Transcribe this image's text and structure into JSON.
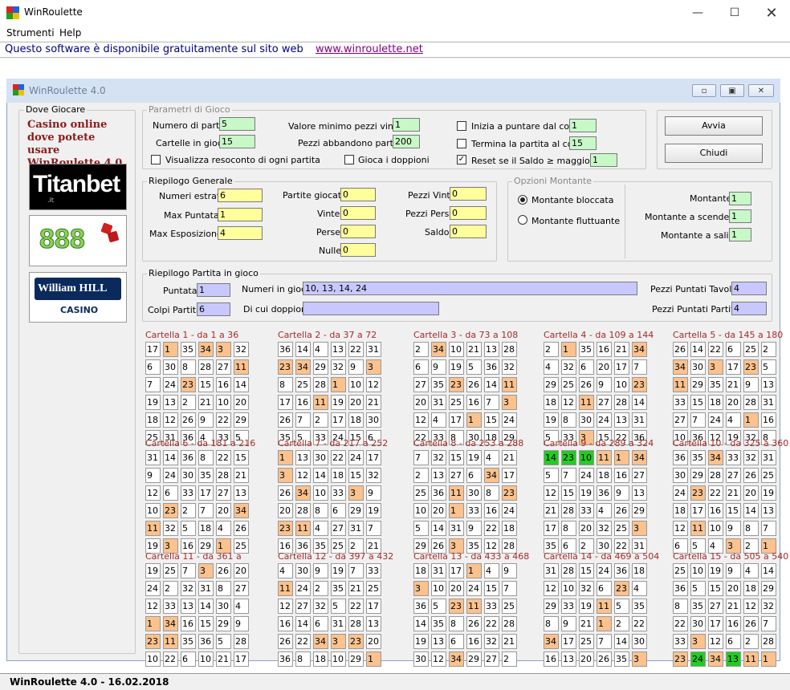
{
  "window": {
    "title": "WinRoulette"
  },
  "menu": [
    "Strumenti",
    "Help"
  ],
  "banner": {
    "text": "Questo software è disponibile gratuitamente sul sito web",
    "link": "www.winroulette.net"
  },
  "child": {
    "title": "WinRoulette 4.0"
  },
  "dove_giocare": {
    "legend": "Dove Giocare",
    "promo": "Casino online dove potete usare WinRoulette 4.0",
    "logos": [
      {
        "name": "Titanbet",
        "text": "Titanbet",
        "sub": ".it"
      },
      {
        "name": "888",
        "text": "888"
      },
      {
        "name": "William Hill",
        "text": "William HILL",
        "sub": "CASINO"
      }
    ]
  },
  "parametri": {
    "legend": "Parametri di Gioco",
    "numero_partite": {
      "label": "Numero di partite",
      "value": "5"
    },
    "cartelle_in_gioco": {
      "label": "Cartelle in gioco",
      "value": "15"
    },
    "visualizza": {
      "label": "Visualizza resoconto di ogni partita",
      "checked": false
    },
    "valore_minimo": {
      "label": "Valore minimo pezzi vincita",
      "value": "1"
    },
    "pezzi_abbandono": {
      "label": "Pezzi abbandono partita",
      "value": "200"
    },
    "gioca_doppioni": {
      "label": "Gioca i doppioni",
      "checked": false
    },
    "inizia": {
      "label": "Inizia a puntare dal colpo",
      "value": "1",
      "checked": false
    },
    "termina": {
      "label": "Termina la partita al colpo",
      "value": "15",
      "checked": false
    },
    "reset": {
      "label": "Reset se il Saldo ≥ maggiore di",
      "value": "1",
      "checked": true
    }
  },
  "buttons": {
    "avvia": "Avvia",
    "chiudi": "Chiudi"
  },
  "riepilogo_generale": {
    "legend": "Riepilogo Generale",
    "numeri_estratti": {
      "label": "Numeri estratti",
      "value": "6"
    },
    "max_puntata": {
      "label": "Max Puntata",
      "value": "1"
    },
    "max_esposizione": {
      "label": "Max Esposizione",
      "value": "4"
    },
    "partite_giocate": {
      "label": "Partite giocate",
      "value": "0"
    },
    "vinte": {
      "label": "Vinte",
      "value": "0"
    },
    "perse": {
      "label": "Perse",
      "value": "0"
    },
    "nulle": {
      "label": "Nulle",
      "value": "0"
    },
    "pezzi_vinti": {
      "label": "Pezzi Vinti",
      "value": "0"
    },
    "pezzi_persi": {
      "label": "Pezzi Persi",
      "value": "0"
    },
    "saldo": {
      "label": "Saldo",
      "value": "0"
    }
  },
  "opzioni_montante": {
    "legend": "Opzioni Montante",
    "bloccata": {
      "label": "Montante bloccata",
      "selected": true
    },
    "fluttuante": {
      "label": "Montante fluttuante",
      "selected": false
    },
    "montante": {
      "label": "Montante",
      "value": "1"
    },
    "scendere": {
      "label": "Montante a scendere",
      "value": "1"
    },
    "salire": {
      "label": "Montante a salire",
      "value": "1"
    }
  },
  "riepilogo_partita": {
    "legend": "Riepilogo Partita in gioco",
    "puntata": {
      "label": "Puntata",
      "value": "1"
    },
    "colpi_partita": {
      "label": "Colpi Partita",
      "value": "6"
    },
    "numeri_in_gioco": {
      "label": "Numeri in gioco",
      "value": "10, 13, 14, 24"
    },
    "di_cui_doppioni": {
      "label": "Di cui doppioni",
      "value": ""
    },
    "pezzi_tavolo": {
      "label": "Pezzi Puntati Tavolo",
      "value": "4"
    },
    "pezzi_partita": {
      "label": "Pezzi Puntati Partita",
      "value": "4"
    }
  },
  "cartelle": [
    {
      "title": "Cartella 1 - da 1 a 36",
      "rows": [
        [
          "17",
          "1",
          "35",
          "34",
          "3",
          "32"
        ],
        [
          "6",
          "30",
          "8",
          "28",
          "27",
          "11"
        ],
        [
          "7",
          "24",
          "23",
          "15",
          "16",
          "14"
        ],
        [
          "19",
          "13",
          "2",
          "21",
          "10",
          "20"
        ],
        [
          "18",
          "12",
          "26",
          "9",
          "22",
          "29"
        ],
        [
          "25",
          "31",
          "36",
          "4",
          "33",
          "5"
        ]
      ],
      "marks": [
        [
          0,
          1
        ],
        [
          0,
          3
        ],
        [
          0,
          4
        ],
        [
          1,
          5
        ],
        [
          2,
          2
        ]
      ]
    },
    {
      "title": "Cartella 2 - da 37 a 72",
      "rows": [
        [
          "36",
          "14",
          "4",
          "13",
          "22",
          "31"
        ],
        [
          "23",
          "34",
          "29",
          "32",
          "9",
          "3"
        ],
        [
          "8",
          "25",
          "28",
          "1",
          "10",
          "12"
        ],
        [
          "17",
          "16",
          "11",
          "19",
          "20",
          "21"
        ],
        [
          "26",
          "7",
          "2",
          "17",
          "18",
          "30"
        ],
        [
          "35",
          "5",
          "33",
          "24",
          "15",
          "6"
        ]
      ],
      "marks": [
        [
          1,
          0
        ],
        [
          1,
          1
        ],
        [
          1,
          5
        ],
        [
          2,
          3
        ],
        [
          3,
          2
        ]
      ]
    },
    {
      "title": "Cartella 3 - da 73 a 108",
      "rows": [
        [
          "2",
          "34",
          "10",
          "21",
          "13",
          "28"
        ],
        [
          "6",
          "9",
          "19",
          "5",
          "36",
          "32"
        ],
        [
          "27",
          "35",
          "23",
          "26",
          "14",
          "11"
        ],
        [
          "20",
          "31",
          "25",
          "16",
          "7",
          "3"
        ],
        [
          "12",
          "4",
          "17",
          "1",
          "15",
          "24"
        ],
        [
          "22",
          "33",
          "8",
          "30",
          "18",
          "29"
        ]
      ],
      "marks": [
        [
          0,
          1
        ],
        [
          2,
          2
        ],
        [
          2,
          5
        ],
        [
          3,
          5
        ],
        [
          4,
          3
        ]
      ]
    },
    {
      "title": "Cartella 4 - da 109 a 144",
      "rows": [
        [
          "2",
          "1",
          "35",
          "16",
          "21",
          "34"
        ],
        [
          "4",
          "32",
          "6",
          "20",
          "17",
          "7"
        ],
        [
          "29",
          "25",
          "26",
          "9",
          "10",
          "23"
        ],
        [
          "18",
          "12",
          "11",
          "27",
          "28",
          "14"
        ],
        [
          "19",
          "8",
          "30",
          "24",
          "13",
          "31"
        ],
        [
          "5",
          "33",
          "3",
          "15",
          "22",
          "36"
        ]
      ],
      "marks": [
        [
          0,
          1
        ],
        [
          0,
          5
        ],
        [
          2,
          5
        ],
        [
          3,
          2
        ],
        [
          5,
          2
        ]
      ]
    },
    {
      "title": "Cartella 5 - da 145 a 180",
      "rows": [
        [
          "26",
          "14",
          "22",
          "6",
          "25",
          "2"
        ],
        [
          "34",
          "30",
          "3",
          "17",
          "23",
          "5"
        ],
        [
          "11",
          "29",
          "35",
          "21",
          "9",
          "13"
        ],
        [
          "33",
          "15",
          "18",
          "20",
          "28",
          "31"
        ],
        [
          "27",
          "7",
          "24",
          "4",
          "1",
          "16"
        ],
        [
          "10",
          "36",
          "12",
          "19",
          "32",
          "8"
        ]
      ],
      "marks": [
        [
          1,
          0
        ],
        [
          1,
          2
        ],
        [
          1,
          4
        ],
        [
          2,
          0
        ],
        [
          4,
          4
        ]
      ]
    },
    {
      "title": "Cartella 6 - da 181 a 216",
      "rows": [
        [
          "31",
          "14",
          "36",
          "8",
          "22",
          "15"
        ],
        [
          "9",
          "24",
          "30",
          "35",
          "28",
          "21"
        ],
        [
          "12",
          "6",
          "33",
          "17",
          "27",
          "13"
        ],
        [
          "10",
          "23",
          "2",
          "7",
          "20",
          "34"
        ],
        [
          "11",
          "32",
          "5",
          "18",
          "4",
          "26"
        ],
        [
          "19",
          "3",
          "16",
          "29",
          "1",
          "25"
        ]
      ],
      "marks": [
        [
          3,
          1
        ],
        [
          3,
          5
        ],
        [
          4,
          0
        ],
        [
          5,
          1
        ],
        [
          5,
          4
        ]
      ]
    },
    {
      "title": "Cartella 7 - da 217 a 252",
      "rows": [
        [
          "1",
          "13",
          "30",
          "22",
          "24",
          "17"
        ],
        [
          "3",
          "12",
          "14",
          "18",
          "15",
          "32"
        ],
        [
          "26",
          "34",
          "10",
          "33",
          "3",
          "9"
        ],
        [
          "20",
          "28",
          "8",
          "6",
          "29",
          "19"
        ],
        [
          "23",
          "11",
          "4",
          "27",
          "31",
          "7"
        ],
        [
          "16",
          "36",
          "35",
          "25",
          "2",
          "21"
        ]
      ],
      "marks": [
        [
          0,
          0
        ],
        [
          1,
          0
        ],
        [
          2,
          1
        ],
        [
          2,
          4
        ],
        [
          4,
          0
        ],
        [
          4,
          1
        ]
      ]
    },
    {
      "title": "Cartella 8 - da 253 a 288",
      "rows": [
        [
          "7",
          "32",
          "15",
          "19",
          "4",
          "21"
        ],
        [
          "2",
          "13",
          "27",
          "6",
          "34",
          "17"
        ],
        [
          "25",
          "36",
          "11",
          "30",
          "8",
          "23"
        ],
        [
          "10",
          "20",
          "1",
          "33",
          "16",
          "24"
        ],
        [
          "5",
          "14",
          "31",
          "9",
          "22",
          "18"
        ],
        [
          "29",
          "26",
          "3",
          "35",
          "12",
          "28"
        ]
      ],
      "marks": [
        [
          1,
          4
        ],
        [
          2,
          2
        ],
        [
          2,
          5
        ],
        [
          3,
          2
        ],
        [
          5,
          2
        ]
      ]
    },
    {
      "title": "Cartella 9 - da 289 a 324",
      "rows": [
        [
          "14",
          "23",
          "10",
          "11",
          "1",
          "34"
        ],
        [
          "5",
          "7",
          "24",
          "18",
          "16",
          "27"
        ],
        [
          "12",
          "15",
          "19",
          "36",
          "9",
          "13"
        ],
        [
          "21",
          "28",
          "33",
          "4",
          "26",
          "29"
        ],
        [
          "17",
          "8",
          "20",
          "32",
          "25",
          "3"
        ],
        [
          "35",
          "6",
          "2",
          "30",
          "22",
          "31"
        ]
      ],
      "marks": [
        [
          0,
          3
        ],
        [
          0,
          4
        ],
        [
          0,
          5
        ],
        [
          4,
          5
        ]
      ],
      "green": [
        [
          0,
          0
        ],
        [
          0,
          1
        ],
        [
          0,
          2
        ]
      ]
    },
    {
      "title": "Cartella 10 - da 325 a 360",
      "rows": [
        [
          "36",
          "35",
          "34",
          "33",
          "32",
          "31"
        ],
        [
          "30",
          "29",
          "28",
          "27",
          "26",
          "25"
        ],
        [
          "24",
          "23",
          "22",
          "21",
          "20",
          "19"
        ],
        [
          "18",
          "17",
          "16",
          "15",
          "14",
          "13"
        ],
        [
          "12",
          "11",
          "10",
          "9",
          "8",
          "7"
        ],
        [
          "6",
          "5",
          "4",
          "3",
          "2",
          "1"
        ]
      ],
      "marks": [
        [
          0,
          2
        ],
        [
          2,
          1
        ],
        [
          4,
          1
        ],
        [
          5,
          3
        ],
        [
          5,
          5
        ]
      ]
    },
    {
      "title": "Cartella 11 - da 361 a",
      "rows": [
        [
          "19",
          "25",
          "7",
          "3",
          "26",
          "20"
        ],
        [
          "24",
          "2",
          "32",
          "31",
          "8",
          "27"
        ],
        [
          "12",
          "33",
          "13",
          "14",
          "30",
          "4"
        ],
        [
          "1",
          "34",
          "16",
          "15",
          "29",
          "9"
        ],
        [
          "23",
          "11",
          "35",
          "36",
          "5",
          "28"
        ],
        [
          "10",
          "22",
          "6",
          "10",
          "21",
          "17"
        ]
      ],
      "marks": [
        [
          0,
          3
        ],
        [
          3,
          0
        ],
        [
          3,
          1
        ],
        [
          4,
          0
        ],
        [
          4,
          1
        ]
      ]
    },
    {
      "title": "Cartella 12 - da 397 a 432",
      "rows": [
        [
          "4",
          "30",
          "9",
          "19",
          "7",
          "33"
        ],
        [
          "11",
          "24",
          "2",
          "35",
          "21",
          "25"
        ],
        [
          "12",
          "27",
          "32",
          "5",
          "22",
          "17"
        ],
        [
          "16",
          "14",
          "6",
          "31",
          "28",
          "13"
        ],
        [
          "26",
          "22",
          "34",
          "3",
          "23",
          "20"
        ],
        [
          "36",
          "8",
          "18",
          "10",
          "29",
          "1"
        ]
      ],
      "marks": [
        [
          1,
          0
        ],
        [
          4,
          2
        ],
        [
          4,
          3
        ],
        [
          4,
          4
        ],
        [
          5,
          5
        ]
      ]
    },
    {
      "title": "Cartella 13 - da 433 a 468",
      "rows": [
        [
          "18",
          "31",
          "17",
          "1",
          "4",
          "9"
        ],
        [
          "3",
          "10",
          "20",
          "24",
          "15",
          "7"
        ],
        [
          "36",
          "5",
          "23",
          "11",
          "33",
          "25"
        ],
        [
          "14",
          "35",
          "8",
          "26",
          "22",
          "28"
        ],
        [
          "19",
          "13",
          "6",
          "16",
          "32",
          "21"
        ],
        [
          "30",
          "12",
          "34",
          "29",
          "27",
          "2"
        ]
      ],
      "marks": [
        [
          0,
          3
        ],
        [
          1,
          0
        ],
        [
          2,
          2
        ],
        [
          2,
          3
        ],
        [
          5,
          2
        ]
      ]
    },
    {
      "title": "Cartella 14 - da 469 a 504",
      "rows": [
        [
          "31",
          "28",
          "15",
          "24",
          "36",
          "18"
        ],
        [
          "12",
          "10",
          "32",
          "6",
          "23",
          "4"
        ],
        [
          "29",
          "33",
          "19",
          "11",
          "5",
          "35"
        ],
        [
          "8",
          "9",
          "21",
          "1",
          "2",
          "22"
        ],
        [
          "34",
          "17",
          "25",
          "7",
          "14",
          "30"
        ],
        [
          "16",
          "13",
          "20",
          "26",
          "35",
          "3"
        ]
      ],
      "marks": [
        [
          1,
          4
        ],
        [
          2,
          3
        ],
        [
          3,
          3
        ],
        [
          4,
          0
        ],
        [
          5,
          5
        ]
      ]
    },
    {
      "title": "Cartella 15 - da 505 a 540",
      "rows": [
        [
          "25",
          "10",
          "19",
          "9",
          "4",
          "14"
        ],
        [
          "36",
          "5",
          "15",
          "20",
          "18",
          "29"
        ],
        [
          "8",
          "35",
          "27",
          "21",
          "12",
          "32"
        ],
        [
          "22",
          "30",
          "17",
          "16",
          "26",
          "7"
        ],
        [
          "33",
          "3",
          "12",
          "6",
          "2",
          "28"
        ],
        [
          "23",
          "24",
          "34",
          "13",
          "11",
          "1"
        ]
      ],
      "marks": [
        [
          4,
          1
        ],
        [
          5,
          0
        ],
        [
          5,
          2
        ],
        [
          5,
          4
        ],
        [
          5,
          5
        ]
      ],
      "green": [
        [
          5,
          1
        ],
        [
          5,
          3
        ]
      ]
    }
  ],
  "status": {
    "text": "WinRoulette  4.0   -   16.02.2018"
  },
  "colors": {
    "field_green": "#c8f7c8",
    "field_yellow": "#ffff9c",
    "field_purple": "#c8c8ff",
    "mark_orange": "#fbc28e",
    "mark_green": "#22cc22",
    "title_red": "#a52a2a"
  },
  "icons": [
    "app-logo-icon",
    "minimize-icon",
    "maximize-icon",
    "close-icon",
    "checkmark-icon",
    "radio-dot-icon"
  ]
}
